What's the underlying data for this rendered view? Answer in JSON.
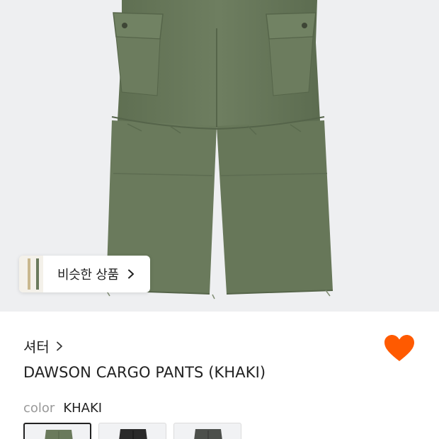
{
  "similar_products": {
    "label": "비슷한 상품"
  },
  "brand": {
    "name": "셔터"
  },
  "product": {
    "title": "DAWSON CARGO PANTS (KHAKI)"
  },
  "color": {
    "label": "color",
    "selected": "KHAKI",
    "options": [
      {
        "name": "KHAKI",
        "hex": "#6a7a5c",
        "selected": true
      },
      {
        "name": "BLACK",
        "hex": "#2a2a2a",
        "selected": false
      },
      {
        "name": "CHARCOAL",
        "hex": "#4c4f4b",
        "selected": false
      }
    ]
  },
  "colors": {
    "heart": "#ff5a00",
    "pants_khaki": "#6b7b5d",
    "background": "#eeeff1"
  },
  "icons": {
    "heart": "heart-icon",
    "chevron": "chevron-right-icon"
  },
  "wishlisted": true
}
